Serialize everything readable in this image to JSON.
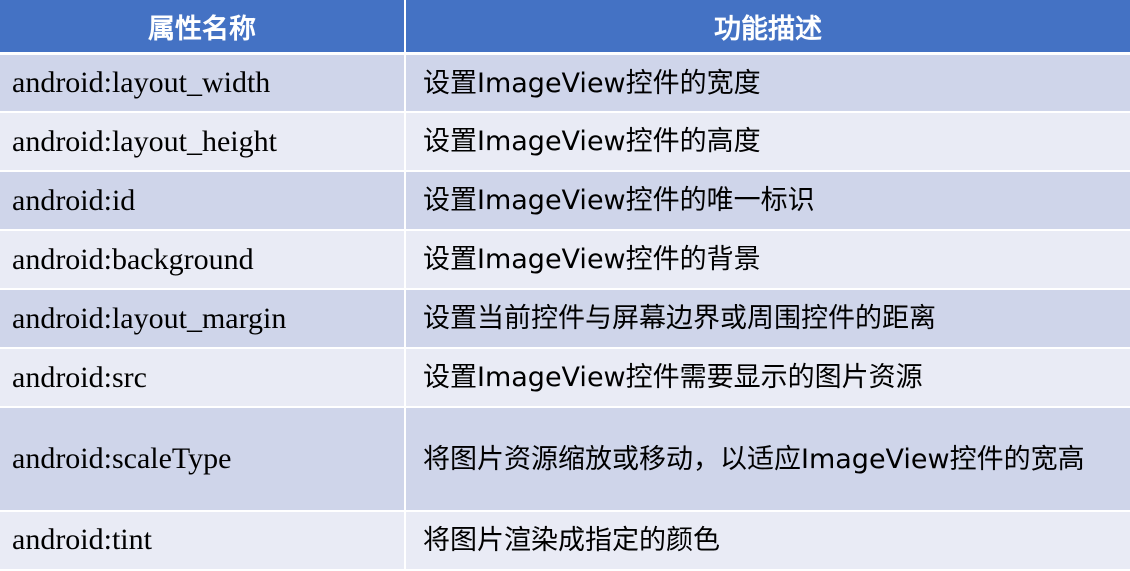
{
  "table": {
    "header": {
      "col_attr": "属性名称",
      "col_desc": "功能描述"
    },
    "rows": [
      {
        "attr": "android:layout_width",
        "desc": "设置ImageView控件的宽度"
      },
      {
        "attr": "android:layout_height",
        "desc": "设置ImageView控件的高度"
      },
      {
        "attr": "android:id",
        "desc": "设置ImageView控件的唯一标识"
      },
      {
        "attr": "android:background",
        "desc": "设置ImageView控件的背景"
      },
      {
        "attr": "android:layout_margin",
        "desc": "设置当前控件与屏幕边界或周围控件的距离"
      },
      {
        "attr": "android:src",
        "desc": "设置ImageView控件需要显示的图片资源"
      },
      {
        "attr": "android:scaleType",
        "desc": "将图片资源缩放或移动，以适应ImageView控件的宽高"
      },
      {
        "attr": "android:tint",
        "desc": "将图片渲染成指定的颜色"
      }
    ]
  },
  "colors": {
    "header_bg": "#4472c4",
    "row_dark": "#cfd5ea",
    "row_light": "#e9ebf5"
  }
}
